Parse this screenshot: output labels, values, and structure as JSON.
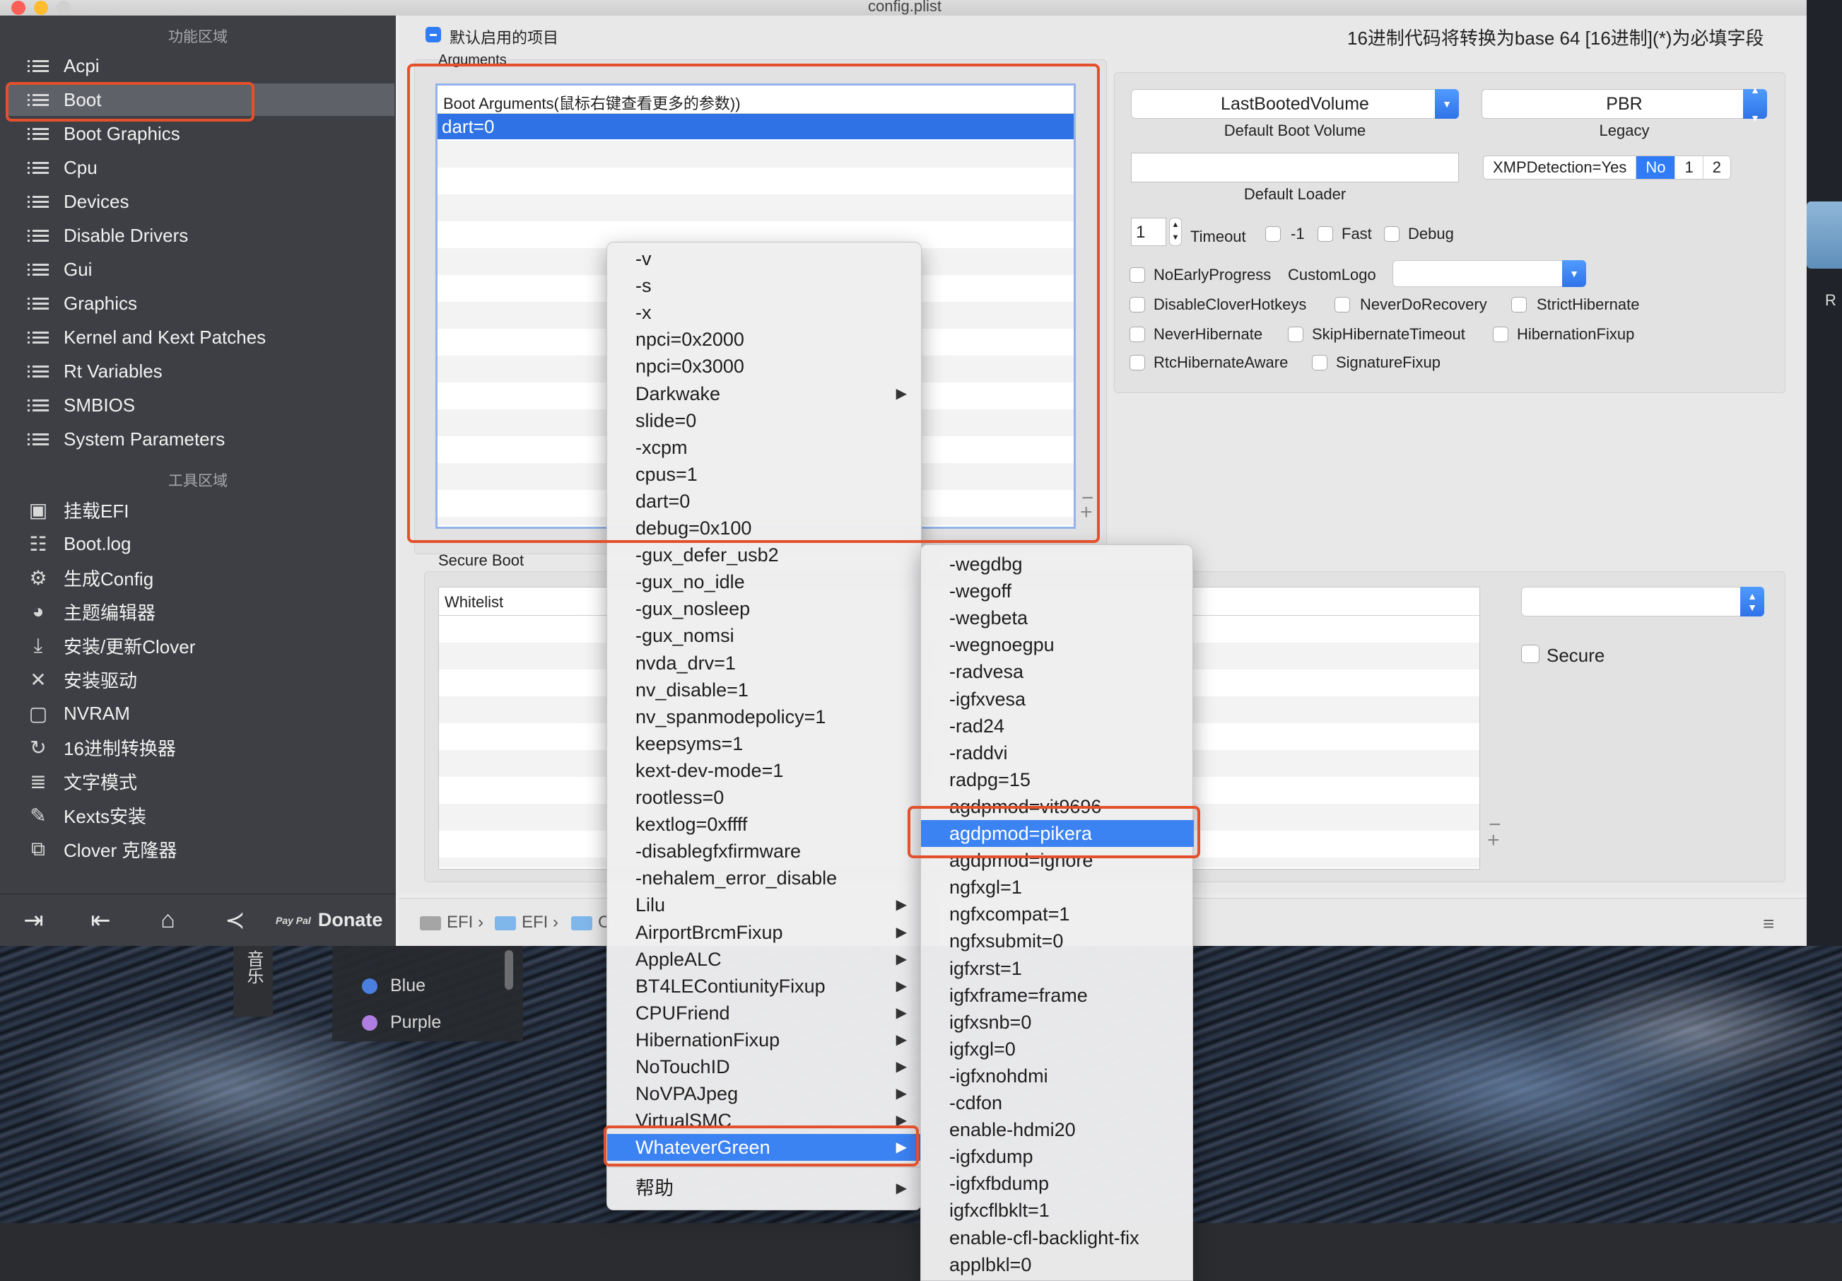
{
  "window": {
    "title": "config.plist"
  },
  "sidebar": {
    "section_config": "功能区域",
    "config_items": [
      {
        "label": "Acpi"
      },
      {
        "label": "Boot"
      },
      {
        "label": "Boot Graphics"
      },
      {
        "label": "Cpu"
      },
      {
        "label": "Devices"
      },
      {
        "label": "Disable Drivers"
      },
      {
        "label": "Gui"
      },
      {
        "label": "Graphics"
      },
      {
        "label": "Kernel and Kext Patches"
      },
      {
        "label": "Rt Variables"
      },
      {
        "label": "SMBIOS"
      },
      {
        "label": "System Parameters"
      }
    ],
    "section_tools": "工具区域",
    "tool_items": [
      {
        "label": "挂载EFI",
        "icon": "disk-icon"
      },
      {
        "label": "Boot.log",
        "icon": "log-icon"
      },
      {
        "label": "生成Config",
        "icon": "gears-icon"
      },
      {
        "label": "主题编辑器",
        "icon": "palette-icon"
      },
      {
        "label": "安装/更新Clover",
        "icon": "download-icon"
      },
      {
        "label": "安装驱动",
        "icon": "tools-icon"
      },
      {
        "label": "NVRAM",
        "icon": "chip-icon"
      },
      {
        "label": "16进制转换器",
        "icon": "refresh-icon"
      },
      {
        "label": "文字模式",
        "icon": "text-icon"
      },
      {
        "label": "Kexts安装",
        "icon": "plug-icon"
      },
      {
        "label": "Clover 克隆器",
        "icon": "clone-icon"
      }
    ],
    "footer": {
      "donate_label": "Donate",
      "paypal_mark": "Pay Pal"
    }
  },
  "header": {
    "default_enabled_label": "默认启用的项目",
    "hex_notice": "16进制代码将转换为base 64 [16进制](*)为必填字段"
  },
  "arguments": {
    "group_title": "Arguments",
    "column_header": "Boot Arguments(鼠标右键查看更多的参数))",
    "rows": [
      "dart=0"
    ]
  },
  "boot_options": {
    "default_volume_value": "LastBootedVolume",
    "default_volume_label": "Default Boot Volume",
    "legacy_value": "PBR",
    "legacy_label": "Legacy",
    "default_loader_value": "",
    "default_loader_label": "Default Loader",
    "xmp_segments": [
      "XMPDetection=Yes",
      "No",
      "1",
      "2"
    ],
    "xmp_selected": "No",
    "timeout_value": "1",
    "timeout_label": "Timeout",
    "minus_one_label": "-1",
    "fast_label": "Fast",
    "debug_label": "Debug",
    "no_early_progress_label": "NoEarlyProgress",
    "custom_logo_label": "CustomLogo",
    "custom_logo_value": "",
    "checkboxes_row1": [
      "DisableCloverHotkeys",
      "NeverDoRecovery",
      "StrictHibernate"
    ],
    "checkboxes_row2": [
      "NeverHibernate",
      "SkipHibernateTimeout",
      "HibernationFixup"
    ],
    "checkboxes_row3": [
      "RtcHibernateAware",
      "SignatureFixup"
    ]
  },
  "secure_boot": {
    "group_title": "Secure Boot",
    "whitelist_header": "Whitelist",
    "policy_value": "",
    "secure_label": "Secure"
  },
  "pathbar": {
    "crumbs": [
      "EFI",
      "EFI",
      "C"
    ]
  },
  "music_widget": {
    "tab_label": "音乐",
    "items": [
      {
        "label": "Blue",
        "color": "#4a7fe0"
      },
      {
        "label": "Purple",
        "color": "#b07ee0"
      }
    ]
  },
  "context_menu": {
    "items": [
      {
        "label": "-v"
      },
      {
        "label": "-s"
      },
      {
        "label": "-x"
      },
      {
        "label": "npci=0x2000"
      },
      {
        "label": "npci=0x3000"
      },
      {
        "label": "Darkwake",
        "submenu": true
      },
      {
        "label": "slide=0"
      },
      {
        "label": "-xcpm"
      },
      {
        "label": "cpus=1"
      },
      {
        "label": "dart=0"
      },
      {
        "label": "debug=0x100"
      },
      {
        "label": "-gux_defer_usb2"
      },
      {
        "label": "-gux_no_idle"
      },
      {
        "label": "-gux_nosleep"
      },
      {
        "label": "-gux_nomsi"
      },
      {
        "label": "nvda_drv=1"
      },
      {
        "label": "nv_disable=1"
      },
      {
        "label": "nv_spanmodepolicy=1"
      },
      {
        "label": "keepsyms=1"
      },
      {
        "label": "kext-dev-mode=1"
      },
      {
        "label": "rootless=0"
      },
      {
        "label": "kextlog=0xffff"
      },
      {
        "label": "-disablegfxfirmware"
      },
      {
        "label": "-nehalem_error_disable"
      },
      {
        "label": "Lilu",
        "submenu": true
      },
      {
        "label": "AirportBrcmFixup",
        "submenu": true
      },
      {
        "label": "AppleALC",
        "submenu": true
      },
      {
        "label": "BT4LEContiunityFixup",
        "submenu": true
      },
      {
        "label": "CPUFriend",
        "submenu": true
      },
      {
        "label": "HibernationFixup",
        "submenu": true
      },
      {
        "label": "NoTouchID",
        "submenu": true
      },
      {
        "label": "NoVPAJpeg",
        "submenu": true
      },
      {
        "label": "VirtualSMC",
        "submenu": true
      },
      {
        "label": "WhateverGreen",
        "submenu": true,
        "highlighted": true
      }
    ],
    "help_label": "帮助"
  },
  "submenu": {
    "items": [
      {
        "label": "-wegdbg"
      },
      {
        "label": "-wegoff"
      },
      {
        "label": "-wegbeta"
      },
      {
        "label": "-wegnoegpu"
      },
      {
        "label": "-radvesa"
      },
      {
        "label": "-igfxvesa"
      },
      {
        "label": "-rad24"
      },
      {
        "label": "-raddvi"
      },
      {
        "label": "radpg=15"
      },
      {
        "label": "agdpmod=vit9696"
      },
      {
        "label": "agdpmod=pikera",
        "highlighted": true
      },
      {
        "label": "agdpmod=ignore"
      },
      {
        "label": "ngfxgl=1"
      },
      {
        "label": "ngfxcompat=1"
      },
      {
        "label": "ngfxsubmit=0"
      },
      {
        "label": "igfxrst=1"
      },
      {
        "label": "igfxframe=frame"
      },
      {
        "label": "igfxsnb=0"
      },
      {
        "label": "igfxgl=0"
      },
      {
        "label": "-igfxnohdmi"
      },
      {
        "label": "-cdfon"
      },
      {
        "label": "enable-hdmi20"
      },
      {
        "label": "-igfxdump"
      },
      {
        "label": "-igfxfbdump"
      },
      {
        "label": "igfxcflbklt=1"
      },
      {
        "label": "enable-cfl-backlight-fix"
      },
      {
        "label": "applbkl=0"
      }
    ]
  },
  "colors": {
    "accent": "#2f7cf6",
    "highlight": "#3b82f3",
    "annotation_red": "#e2512c",
    "sidebar_bg": "#3d3f44"
  }
}
